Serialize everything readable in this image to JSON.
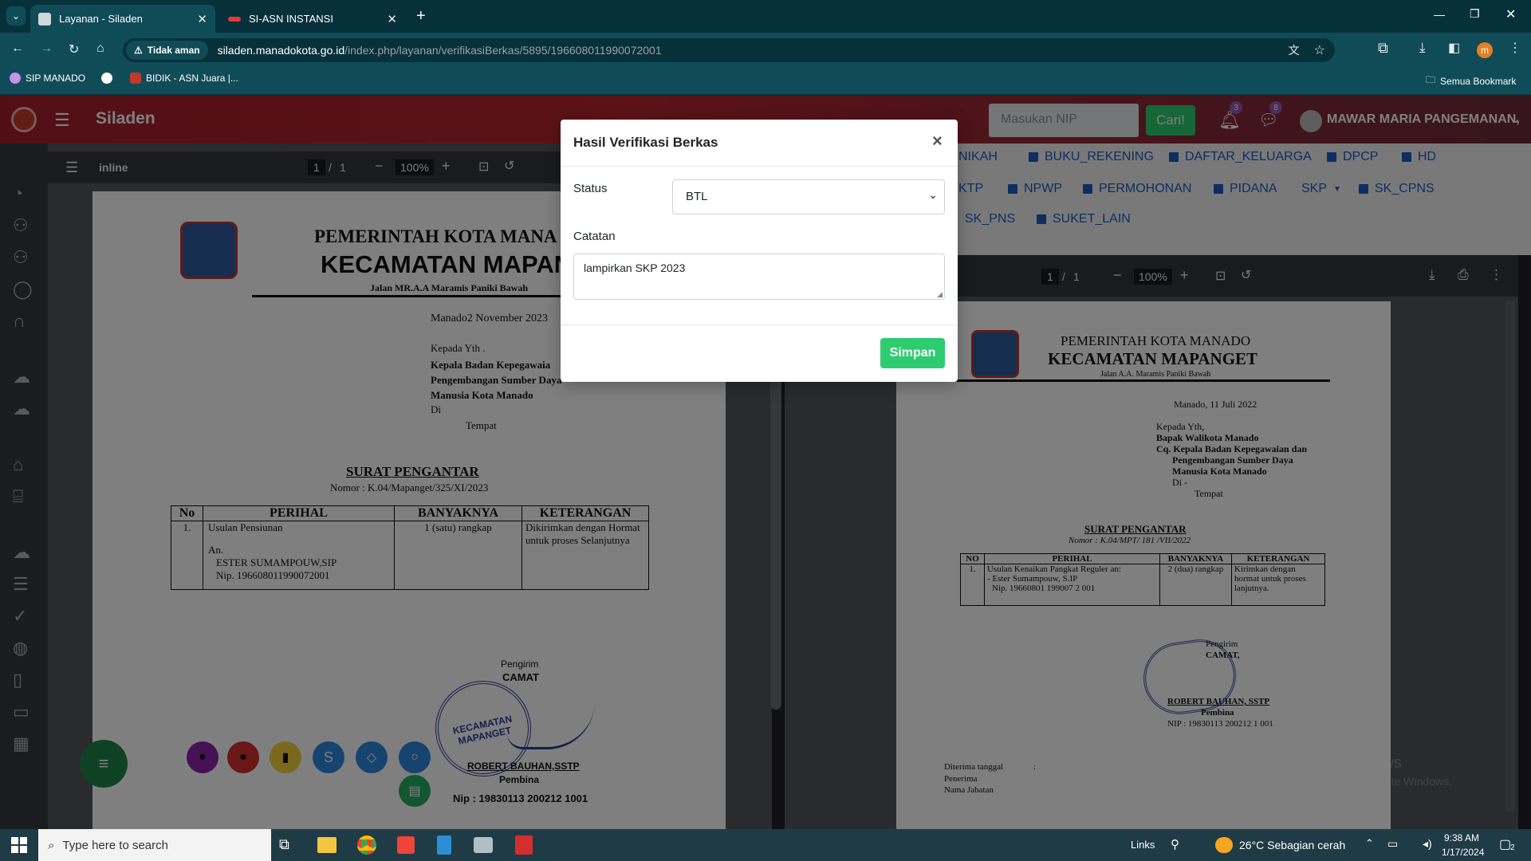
{
  "browser": {
    "tabs": [
      {
        "title": "Layanan - Siladen",
        "active": true
      },
      {
        "title": "SI-ASN INSTANSI",
        "active": false
      }
    ],
    "security_label": "Tidak aman",
    "url_host": "siladen.manadokota.go.id",
    "url_path": "/index.php/layanan/verifikasiBerkas/5895/196608011990072001",
    "bookmarks": [
      "SIP MANADO",
      "BIDIK - ASN Juara |..."
    ],
    "all_bookmarks_label": "Semua Bookmark",
    "profile_initial": "m"
  },
  "app": {
    "name": "Siladen",
    "nip_placeholder": "Masukan NIP",
    "search_button": "Cari!",
    "notif_count": "3",
    "message_count": "8",
    "user_name": "MAWAR MARIA PANGEMANAN,"
  },
  "left_viewer": {
    "title": "inline",
    "page_current": "1",
    "page_sep": "/",
    "page_total": "1",
    "zoom": "100%"
  },
  "left_doc": {
    "gov": "PEMERINTAH KOTA MANA",
    "district": "KECAMATAN MAPANG",
    "street": "Jalan MR.A.A Maramis Paniki Bawah",
    "date": "Manado2 November  2023",
    "kepada": "Kepada Yth .",
    "to1": "Kepala Badan Kepegawaia",
    "to2": "Pengembangan Sumber Daya",
    "to3": "Manusia Kota Manado",
    "di": "Di",
    "tempat": "Tempat",
    "title": "SURAT PENGANTAR",
    "nomor": "Nomor : K.04/Mapanget/325/XI/2023",
    "headers": [
      "No",
      "PERIHAL",
      "BANYAKNYA",
      "KETERANGAN"
    ],
    "row_no": "1.",
    "row_perihal_1": "Usulan Pensiunan",
    "row_perihal_2": "An.",
    "row_perihal_3": "ESTER SUMAMPOUW,SIP",
    "row_perihal_4": "Nip. 196608011990072001",
    "row_banyak": "1 (satu) rangkap",
    "row_ket_1": "Dikirimkan dengan Hormat",
    "row_ket_2": "untuk proses Selanjutnya",
    "pengirim": "Pengirim",
    "camat": "CAMAT",
    "stamp": "KECAMATAN MAPANGET",
    "signer": "ROBERT BAUHAN,SSTP",
    "rank": "Pembina",
    "nip": "Nip : 19830113 200212 1001"
  },
  "doc_tags": {
    "row1": [
      "NIKAH",
      "BUKU_REKENING",
      "DAFTAR_KELUARGA",
      "DPCP",
      "HD"
    ],
    "row2": [
      "KTP",
      "NPWP",
      "PERMOHONAN",
      "PIDANA",
      "SKP",
      "SK_CPNS"
    ],
    "row3": [
      "SK_PNS",
      "SUKET_LAIN"
    ]
  },
  "right_viewer": {
    "page_current": "1",
    "page_sep": "/",
    "page_total": "1",
    "zoom": "100%"
  },
  "right_doc": {
    "gov": "PEMERINTAH KOTA MANADO",
    "district": "KECAMATAN MAPANGET",
    "street": "Jalan A.A. Maramis Paniki Bawah",
    "date": "Manado,  11 Juli 2022",
    "kepada": "Kepada Yth,",
    "to1": "Bapak Walikota Manado",
    "to2": "Cq. Kepala Badan Kepegawaian dan",
    "to3": "Pengembangan Sumber Daya",
    "to4": "Manusia Kota Manado",
    "di": "Di -",
    "tempat": "Tempat",
    "title": "SURAT PENGANTAR",
    "nomor": "Nomor : K.04/MPT/ 181 /VII/2022",
    "headers": [
      "NO",
      "PERIHAL",
      "BANYAKNYA",
      "KETERANGAN"
    ],
    "row_no": "1.",
    "row_perihal_1": "Usulan Kenaikan Pangkat Reguler an:",
    "row_perihal_2": "- Ester Sumampouw, S.IP",
    "row_perihal_3": "Nip. 19660801 199007 2 001",
    "row_banyak": "2 (dua) rangkap",
    "row_ket_1": "Kirimkan dengan",
    "row_ket_2": "hormat untuk proses",
    "row_ket_3": "lanjutnya.",
    "pengirim": "Pengirim",
    "camat": "CAMAT,",
    "signer": "ROBERT BAUHAN, SSTP",
    "rank": "Pembina",
    "nip": "NIP : 19830113 200212 1 001",
    "recv1": "Diterima tanggal",
    "recv2": "Penerima",
    "recv3": "Nama Jabatan",
    "colon": ":"
  },
  "modal": {
    "title": "Hasil Verifikasi Berkas",
    "close": "×",
    "status_label": "Status",
    "status_value": "BTL",
    "catatan_label": "Catatan",
    "catatan_value": "lampirkan SKP 2023",
    "submit": "Simpan"
  },
  "watermark": {
    "line1": "Activate Windows",
    "line2": "Go to Settings to activate Windows."
  },
  "taskbar": {
    "search_placeholder": "Type here to search",
    "links": "Links",
    "weather": "26°C  Sebagian cerah",
    "time": "9:38 AM",
    "date": "1/17/2024",
    "notif": "2"
  }
}
